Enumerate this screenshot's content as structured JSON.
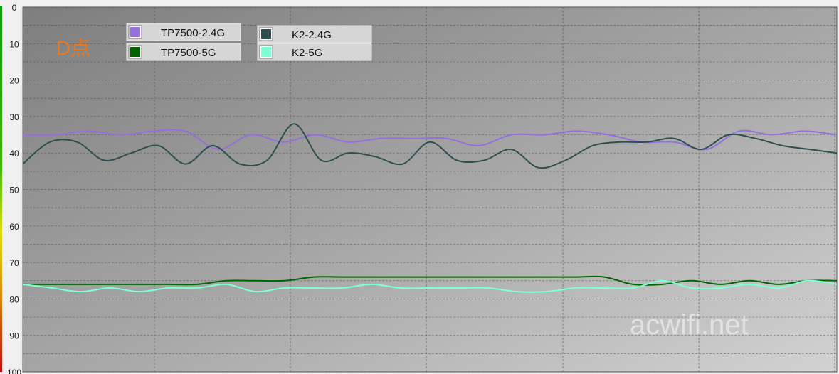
{
  "chart_data": {
    "type": "line",
    "title": "",
    "annotation": "D点",
    "watermark": "acwifi.net",
    "ylim": [
      0,
      100
    ],
    "y_inverted": true,
    "y_ticks": [
      "0",
      "10",
      "20",
      "30",
      "40",
      "50",
      "60",
      "70",
      "80",
      "90",
      "100"
    ],
    "x": [
      0,
      0.4,
      0.8,
      1.2,
      1.6,
      2.0,
      2.4,
      2.8,
      3.2,
      3.6,
      4.0,
      4.4,
      4.8,
      5.2,
      5.6,
      6.0
    ],
    "grid": true,
    "legend_position": "top-left",
    "series": [
      {
        "name": "TP7500-2.4G",
        "color": "#9370db",
        "values": [
          35,
          35,
          34,
          35,
          34,
          34,
          39,
          35,
          37,
          35,
          37,
          36,
          36,
          36,
          38,
          35,
          35,
          34,
          35,
          37,
          37,
          39,
          34,
          35,
          34,
          35
        ]
      },
      {
        "name": "K2-2.4G",
        "color": "#2f4f4f",
        "values": [
          43,
          37,
          37,
          42,
          40,
          38,
          43,
          38,
          43,
          42,
          32,
          42,
          40,
          41,
          43,
          37,
          42,
          42,
          39,
          44,
          42,
          38,
          37,
          37,
          36,
          39,
          35,
          36,
          38,
          39,
          40
        ]
      },
      {
        "name": "TP7500-5G",
        "color": "#006400",
        "values": [
          76,
          76,
          76,
          76,
          76,
          76,
          76,
          75,
          75,
          75,
          74,
          74,
          74,
          74,
          74,
          74,
          74,
          74,
          74,
          74,
          74,
          76,
          76,
          75,
          76,
          75,
          76,
          75,
          75
        ]
      },
      {
        "name": "K2-5G",
        "color": "#7fffd4",
        "values": [
          76,
          77,
          78,
          77,
          78,
          77,
          77,
          76,
          78,
          77,
          77,
          77,
          76,
          77,
          77,
          77,
          77,
          78,
          78,
          77,
          77,
          77,
          75,
          77,
          77,
          76,
          77,
          75,
          76
        ]
      }
    ]
  }
}
